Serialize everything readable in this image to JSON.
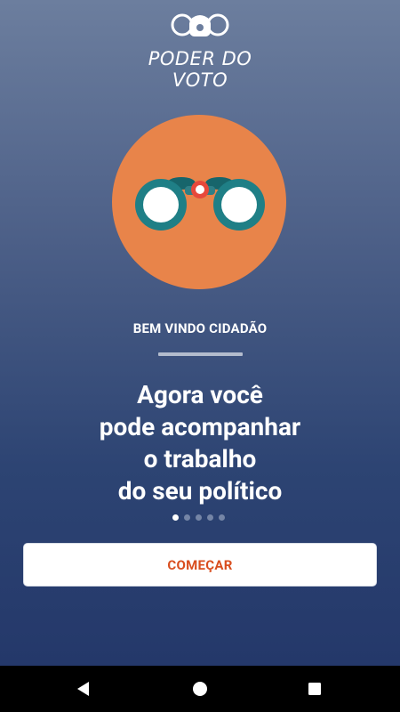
{
  "app": {
    "logo_text": "PODER DO VOTO"
  },
  "onboarding": {
    "welcome": "BEM VINDO CIDADÃO",
    "headline_lines": [
      "Agora você",
      "pode acompanhar",
      "o trabalho",
      "do seu político"
    ],
    "page_indicator": {
      "total": 5,
      "current": 1
    },
    "cta_label": "COMEÇAR"
  },
  "colors": {
    "background_top": "#6c7e9e",
    "background_bottom": "#24386a",
    "hero_circle": "#e8844a",
    "binocular_teal": "#1f7f86",
    "binocular_center": "#e7483b",
    "cta_text": "#d94e1f"
  },
  "navbar": {
    "icons": [
      "back-icon",
      "home-icon",
      "recent-apps-icon"
    ]
  }
}
